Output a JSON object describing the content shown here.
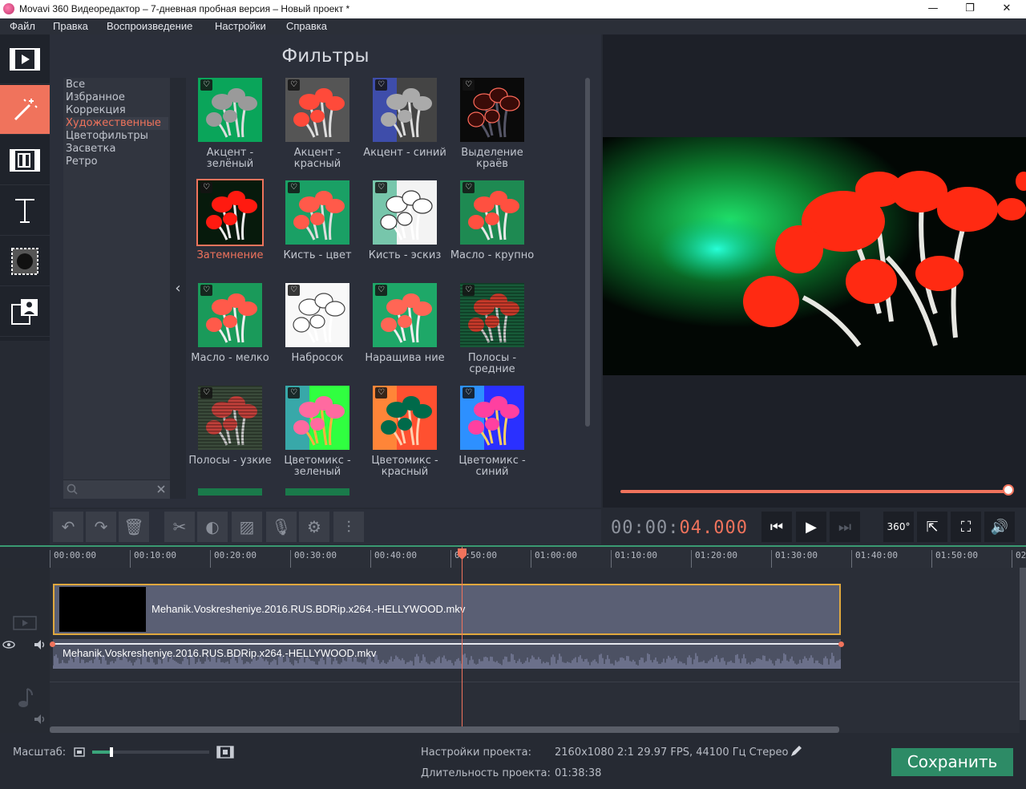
{
  "window": {
    "title": "Movavi 360 Видеоредактор – 7-дневная пробная версия – Новый проект *",
    "minimize": "—",
    "maximize": "❐",
    "close": "✕"
  },
  "menu": [
    "Файл",
    "Правка",
    "Воспроизведение",
    "Настройки",
    "Справка"
  ],
  "left_tools": [
    {
      "icon": "film-import-icon",
      "active": false
    },
    {
      "icon": "magic-wand-icon",
      "active": true
    },
    {
      "icon": "transitions-icon",
      "active": false
    },
    {
      "icon": "text-title-icon",
      "active": false
    },
    {
      "icon": "overlay-shapes-icon",
      "active": false
    },
    {
      "icon": "pip-callout-icon",
      "active": false
    }
  ],
  "filters": {
    "title": "Фильтры",
    "categories": [
      "Все",
      "Избранное",
      "Коррекция",
      "Художественные",
      "Цветофильтры",
      "Засветка",
      "Ретро"
    ],
    "active_category": "Художественные",
    "search_placeholder": "",
    "collapse_glyph": "‹",
    "heart_glyph": "♡",
    "items": [
      {
        "label": "Акцент - зелёный",
        "style": "accent-green"
      },
      {
        "label": "Акцент - красный",
        "style": "accent-red"
      },
      {
        "label": "Акцент - синий",
        "style": "accent-blue"
      },
      {
        "label": "Выделение краёв",
        "style": "edges"
      },
      {
        "label": "Затемнение",
        "style": "darken",
        "selected": true
      },
      {
        "label": "Кисть - цвет",
        "style": "brush-color"
      },
      {
        "label": "Кисть - эскиз",
        "style": "brush-sketch"
      },
      {
        "label": "Масло - крупно",
        "style": "oil-large"
      },
      {
        "label": "Масло - мелко",
        "style": "oil-small"
      },
      {
        "label": "Набросок",
        "style": "sketch"
      },
      {
        "label": "Наращива ние",
        "style": "grow"
      },
      {
        "label": "Полосы - средние",
        "style": "stripes-mid"
      },
      {
        "label": "Полосы - узкие",
        "style": "stripes-narrow"
      },
      {
        "label": "Цветомикс - зеленый",
        "style": "mix-green"
      },
      {
        "label": "Цветомикс - красный",
        "style": "mix-red"
      },
      {
        "label": "Цветомикс - синий",
        "style": "mix-blue"
      }
    ]
  },
  "playback": {
    "timecode_main": "00:00:",
    "timecode_accent": "04.000",
    "progress": 1.0,
    "buttons": {
      "prev": "⏮",
      "play": "▶",
      "next": "⏭",
      "v360": "360°",
      "popout": "⇱",
      "fullscreen": "⛶",
      "volume": "🔊"
    }
  },
  "edit_tools": [
    "undo-icon",
    "redo-icon",
    "delete-icon",
    "cut-icon",
    "color-adjust-icon",
    "image-icon",
    "microphone-icon",
    "gear-icon",
    "equalizer-icon"
  ],
  "edit_glyphs": [
    "↶",
    "↷",
    "🗑",
    "✂",
    "◐",
    "▨",
    "🎙",
    "⚙",
    "⫶"
  ],
  "timeline": {
    "ticks": [
      "00:00:00",
      "00:10:00",
      "00:20:00",
      "00:30:00",
      "00:40:00",
      "00:50:00",
      "01:00:00",
      "01:10:00",
      "01:20:00",
      "01:30:00",
      "01:40:00",
      "01:50:00",
      "02"
    ],
    "video_clip": "Mehanik.Voskresheniye.2016.RUS.BDRip.x264.-HELLYWOOD.mkv",
    "audio_clip": "Mehanik.Voskresheniye.2016.RUS.BDRip.x264.-HELLYWOOD.mkv",
    "playhead_time": "00:50:00"
  },
  "bottom": {
    "zoom_label": "Масштаб:",
    "zoom_level": 0.15,
    "settings_label": "Настройки проекта:",
    "settings_value": "2160x1080 2:1 29.97 FPS, 44100 Гц Стерео",
    "duration_label": "Длительность проекта:",
    "duration_value": "01:38:38",
    "save_label": "Сохранить"
  },
  "colors": {
    "accent": "#f0735c",
    "save": "#2d8b66",
    "clip_border": "#e0a83e"
  }
}
